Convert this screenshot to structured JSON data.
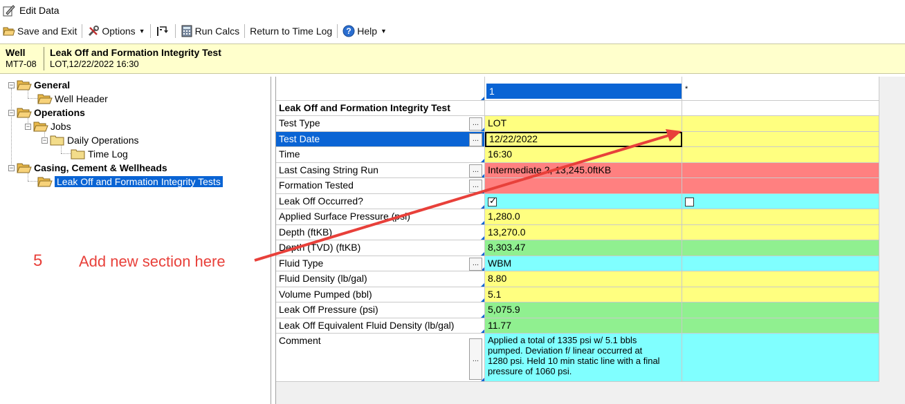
{
  "window": {
    "title": "Edit Data"
  },
  "toolbar": {
    "save_exit": "Save and Exit",
    "options": "Options",
    "run_calcs": "Run Calcs",
    "return_time_log": "Return to Time Log",
    "help": "Help"
  },
  "header": {
    "col1_title": "Well",
    "col1_value": "MT7-08",
    "col2_title": "Leak Off and Formation Integrity Test",
    "col2_value": "LOT,12/22/2022 16:30"
  },
  "tree": {
    "general": "General",
    "well_header": "Well Header",
    "operations": "Operations",
    "jobs": "Jobs",
    "daily_operations": "Daily Operations",
    "time_log": "Time Log",
    "casing": "Casing, Cement & Wellheads",
    "leak_off": "Leak Off and Formation Integrity Tests"
  },
  "grid": {
    "col_record": "1",
    "col_new": "*",
    "section_title": "Leak Off and Formation Integrity Test",
    "rows": [
      {
        "label": "Test Type",
        "value": "LOT"
      },
      {
        "label": "Test Date",
        "value": "12/22/2022"
      },
      {
        "label": "Time",
        "value": "16:30"
      },
      {
        "label": "Last Casing String Run",
        "value": "Intermediate 2, 13,245.0ftKB"
      },
      {
        "label": "Formation Tested",
        "value": ""
      },
      {
        "label": "Leak Off Occurred?",
        "value": ""
      },
      {
        "label": "Applied Surface Pressure (psi)",
        "value": "1,280.0"
      },
      {
        "label": "Depth (ftKB)",
        "value": "13,270.0"
      },
      {
        "label": "Depth (TVD) (ftKB)",
        "value": "8,303.47"
      },
      {
        "label": "Fluid Type",
        "value": "WBM"
      },
      {
        "label": "Fluid Density (lb/gal)",
        "value": "8.80"
      },
      {
        "label": "Volume Pumped (bbl)",
        "value": "5.1"
      },
      {
        "label": "Leak Off Pressure (psi)",
        "value": "5,075.9"
      },
      {
        "label": "Leak Off Equivalent Fluid Density (lb/gal)",
        "value": "11.77"
      },
      {
        "label": "Comment",
        "value": ""
      }
    ],
    "comment_lines": [
      "Applied a total of 1335 psi w/ 5.1 bbls",
      "pumped.  Deviation f/ linear occurred at",
      "1280 psi.  Held 10 min static line with a final",
      "pressure of 1060 psi."
    ],
    "leak_off_occurred_checked": true,
    "new_record_checked": false
  },
  "annotation": {
    "number": "5",
    "text": "Add new section here",
    "color": "#e8403a"
  },
  "colors": {
    "yellow": "#ffff80",
    "red": "#ff8080",
    "cyan": "#80ffff",
    "green": "#90f090",
    "selection": "#0a64d4",
    "header_band": "#ffffcc"
  }
}
